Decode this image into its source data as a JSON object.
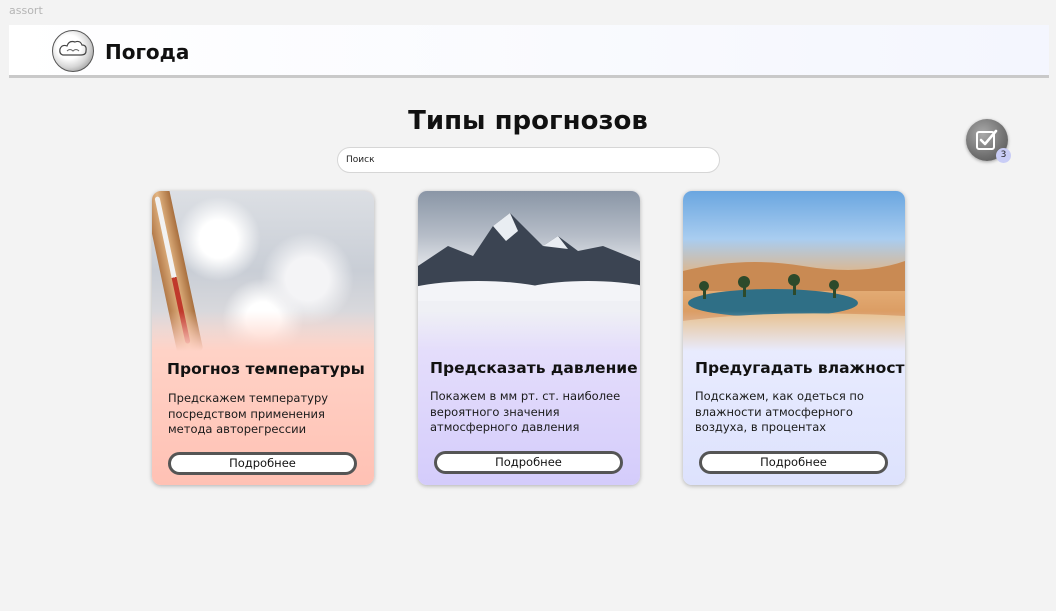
{
  "window": {
    "title": "assort"
  },
  "header": {
    "brand": "Погода",
    "logo_icon": "cloud-logo-icon"
  },
  "main": {
    "title": "Типы прогнозов",
    "search": {
      "placeholder": "Поиск",
      "value": ""
    },
    "selection": {
      "icon": "checkbox-icon",
      "count": "3"
    }
  },
  "cards": [
    {
      "image": "thermometer-snow-image",
      "title": "Прогноз температуры",
      "description": "Предскажем температуру посредством применения метода авторегрессии",
      "button": "Подробнее",
      "color": "#ffc7ba"
    },
    {
      "image": "mountain-clouds-image",
      "title": "Предсказать давление",
      "description": "Покажем в мм рт. ст. наиболее вероятного значения атмосферного давления",
      "button": "Подробнее",
      "color": "#d9d1fb"
    },
    {
      "image": "desert-oasis-image",
      "title": "Предугадать влажность",
      "description": "Подскажем, как одеться по влажности атмосферного воздуха, в процентах",
      "button": "Подробнее",
      "color": "#e2e6fd"
    }
  ]
}
